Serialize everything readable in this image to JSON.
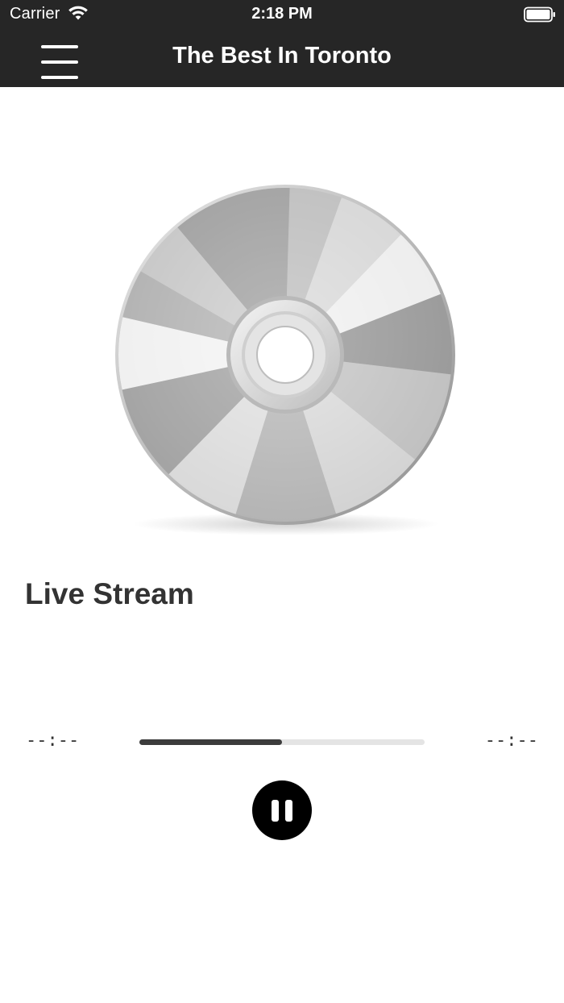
{
  "status_bar": {
    "carrier": "Carrier",
    "time": "2:18 PM",
    "wifi_icon": "wifi-icon",
    "battery_icon": "battery-icon"
  },
  "nav": {
    "menu_icon": "hamburger-menu-icon",
    "title": "The Best In Toronto"
  },
  "artwork": {
    "icon": "compact-disc-icon"
  },
  "player": {
    "track_title": "Live Stream",
    "elapsed": "--:--",
    "remaining": "--:--",
    "progress": 0.5,
    "control_icon": "pause-icon",
    "state": "playing"
  },
  "colors": {
    "bar_background": "#262626",
    "progress_fill": "#3c3c3c",
    "progress_track": "#e4e4e4",
    "control_background": "#000000"
  }
}
